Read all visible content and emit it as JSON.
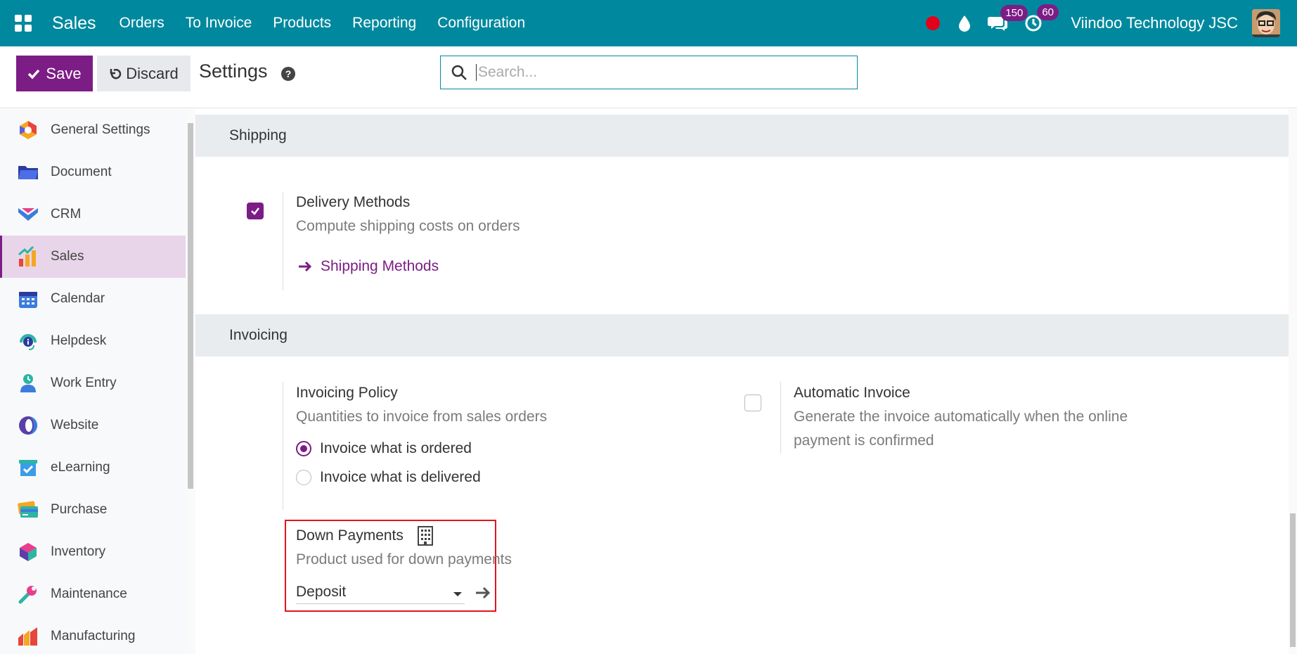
{
  "navbar": {
    "brand": "Sales",
    "menu": [
      "Orders",
      "To Invoice",
      "Products",
      "Reporting",
      "Configuration"
    ],
    "messages_count": "150",
    "activities_count": "60",
    "company": "Viindoo Technology JSC"
  },
  "control": {
    "save_label": "Save",
    "discard_label": "Discard",
    "title": "Settings",
    "search_placeholder": "Search..."
  },
  "sidebar": {
    "items": [
      {
        "label": "General Settings",
        "icon": "general-settings-icon"
      },
      {
        "label": "Document",
        "icon": "folder-icon"
      },
      {
        "label": "CRM",
        "icon": "crm-icon"
      },
      {
        "label": "Sales",
        "icon": "sales-chart-icon",
        "active": true
      },
      {
        "label": "Calendar",
        "icon": "calendar-icon"
      },
      {
        "label": "Helpdesk",
        "icon": "headset-icon"
      },
      {
        "label": "Work Entry",
        "icon": "user-clock-icon"
      },
      {
        "label": "Website",
        "icon": "website-icon"
      },
      {
        "label": "eLearning",
        "icon": "elearning-icon"
      },
      {
        "label": "Purchase",
        "icon": "credit-card-icon"
      },
      {
        "label": "Inventory",
        "icon": "box-icon"
      },
      {
        "label": "Maintenance",
        "icon": "wrench-icon"
      },
      {
        "label": "Manufacturing",
        "icon": "manufacturing-icon"
      }
    ]
  },
  "shipping": {
    "header": "Shipping",
    "delivery_title": "Delivery Methods",
    "delivery_desc": "Compute shipping costs on orders",
    "delivery_checked": true,
    "link": "Shipping Methods"
  },
  "invoicing": {
    "header": "Invoicing",
    "policy_title": "Invoicing Policy",
    "policy_desc": "Quantities to invoice from sales orders",
    "options": [
      "Invoice what is ordered",
      "Invoice what is delivered"
    ],
    "selected_option": "Invoice what is ordered",
    "auto_title": "Automatic Invoice",
    "auto_desc_1": "Generate the invoice automatically when the online",
    "auto_desc_2": "payment is confirmed",
    "auto_checked": false,
    "down_title": "Down Payments",
    "down_desc": "Product used for down payments",
    "down_value": "Deposit"
  },
  "colors": {
    "navbar": "#00899e",
    "primary": "#7c1d86",
    "highlight": "#e2141e"
  }
}
